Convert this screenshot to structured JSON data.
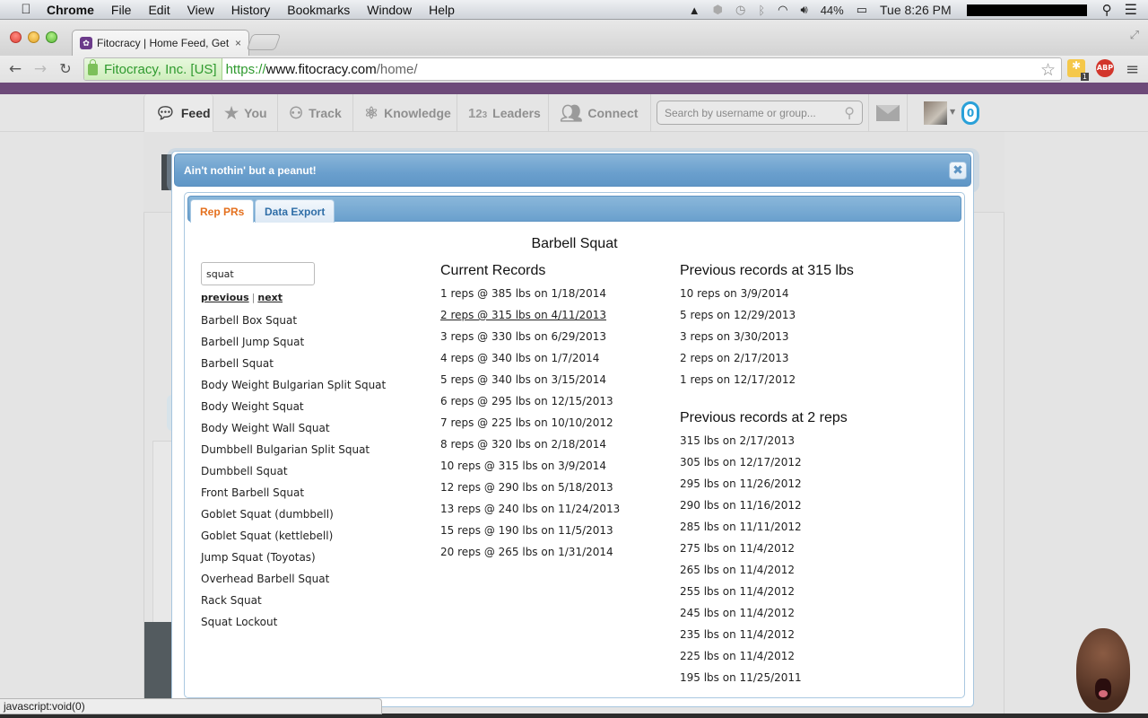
{
  "menubar": {
    "app": "Chrome",
    "menus": [
      "File",
      "Edit",
      "View",
      "History",
      "Bookmarks",
      "Window",
      "Help"
    ],
    "battery": "44%",
    "clock": "Tue 8:26 PM"
  },
  "browser": {
    "tab_title": "Fitocracy | Home Feed, Get",
    "tab_close": "×",
    "ev_cert": "Fitocracy, Inc. [US]",
    "url_scheme": "https://",
    "url_host": "www.fitocracy.com",
    "url_path": "/home/",
    "ext_badge": "1",
    "abp_label": "ABP",
    "status_text": "javascript:void(0)"
  },
  "site_nav": {
    "items": [
      {
        "label": "Feed",
        "icon": "speech-bubble-icon"
      },
      {
        "label": "You",
        "icon": "star-icon"
      },
      {
        "label": "Track",
        "icon": "track-icon"
      },
      {
        "label": "Knowledge",
        "icon": "atom-icon"
      },
      {
        "label": "Leaders",
        "icon": "123-icon"
      },
      {
        "label": "Connect",
        "icon": "people-icon"
      }
    ],
    "search_placeholder": "Search by username or group...",
    "notification_count": "0"
  },
  "modal": {
    "title": "Ain't nothin' but a peanut!",
    "close_label": "✖",
    "tabs": [
      {
        "label": "Rep PRs",
        "active": true
      },
      {
        "label": "Data Export",
        "active": false
      }
    ],
    "exercise_title": "Barbell Squat",
    "search_value": "squat",
    "pager": {
      "previous": "previous",
      "separator": "|",
      "next": "next"
    },
    "exercises": [
      "Barbell Box Squat",
      "Barbell Jump Squat",
      "Barbell Squat",
      "Body Weight Bulgarian Split Squat",
      "Body Weight Squat",
      "Body Weight Wall Squat",
      "Dumbbell Bulgarian Split Squat",
      "Dumbbell Squat",
      "Front Barbell Squat",
      "Goblet Squat (dumbbell)",
      "Goblet Squat (kettlebell)",
      "Jump Squat (Toyotas)",
      "Overhead Barbell Squat",
      "Rack Squat",
      "Squat Lockout"
    ],
    "current_records": {
      "heading": "Current Records",
      "rows": [
        "1 reps @ 385 lbs on 1/18/2014",
        "2 reps @ 315 lbs on 4/11/2013",
        "3 reps @ 330 lbs on 6/29/2013",
        "4 reps @ 340 lbs on 1/7/2014",
        "5 reps @ 340 lbs on 3/15/2014",
        "6 reps @ 295 lbs on 12/15/2013",
        "7 reps @ 225 lbs on 10/10/2012",
        "8 reps @ 320 lbs on 2/18/2014",
        "10 reps @ 315 lbs on 3/9/2014",
        "12 reps @ 290 lbs on 5/18/2013",
        "13 reps @ 240 lbs on 11/24/2013",
        "15 reps @ 190 lbs on 11/5/2013",
        "20 reps @ 265 lbs on 1/31/2014"
      ],
      "hovered_index": 1
    },
    "previous_at_weight": {
      "heading": "Previous records at 315 lbs",
      "rows": [
        "10 reps on 3/9/2014",
        "5 reps on 12/29/2013",
        "3 reps on 3/30/2013",
        "2 reps on 2/17/2013",
        "1 reps on 12/17/2012"
      ]
    },
    "previous_at_reps": {
      "heading": "Previous records at 2 reps",
      "rows": [
        "315 lbs on 2/17/2013",
        "305 lbs on 12/17/2012",
        "295 lbs on 11/26/2012",
        "290 lbs on 11/16/2012",
        "285 lbs on 11/11/2012",
        "275 lbs on 11/4/2012",
        "265 lbs on 11/4/2012",
        "255 lbs on 11/4/2012",
        "245 lbs on 11/4/2012",
        "235 lbs on 11/4/2012",
        "225 lbs on 11/4/2012",
        "195 lbs on 11/25/2011"
      ]
    }
  },
  "colors": {
    "brand_purple": "#6d4a79",
    "modal_blue": "#6a9fcd",
    "active_tab_orange": "#e4701e",
    "notification_blue": "#29a0d8"
  }
}
